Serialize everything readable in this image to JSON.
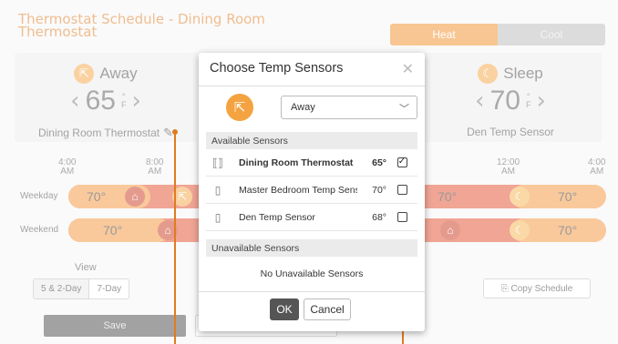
{
  "app": {
    "title": "Thermostat Schedule - Dining Room Thermostat",
    "mode_heat": "Heat",
    "mode_cool": "Cool",
    "left_panel": {
      "mode": "Away",
      "temp": "65",
      "unit_deg": "°",
      "unit_f": "F",
      "label": "Dining Room Thermostat"
    },
    "right_panel": {
      "mode": "Sleep",
      "temp": "70",
      "unit_deg": "°",
      "unit_f": "F",
      "label": "Den Temp Sensor"
    },
    "time_axis": [
      {
        "time": "4:00",
        "ampm": "AM"
      },
      {
        "time": "8:00",
        "ampm": "AM"
      },
      {
        "time": "12:00",
        "ampm": "AM"
      },
      {
        "time": "4:00",
        "ampm": "AM"
      }
    ],
    "rows": {
      "weekday_label": "Weekday",
      "weekend_label": "Weekend",
      "temp": "70°"
    },
    "view_label": "View",
    "view_options": [
      "5 & 2-Day",
      "7-Day"
    ],
    "copy_schedule": "Copy Schedule",
    "save": "Save"
  },
  "modal": {
    "title": "Choose Temp Sensors",
    "close": "✕",
    "mode_select": "Away",
    "available_header": "Available Sensors",
    "sensors": [
      {
        "name": "Dining Room Thermostat",
        "temp": "65°",
        "checked": true
      },
      {
        "name": "Master Bedroom Temp Sens...",
        "temp": "70°",
        "checked": false
      },
      {
        "name": "Den Temp Sensor",
        "temp": "68°",
        "checked": false
      }
    ],
    "unavailable_header": "Unavailable Sensors",
    "no_unavailable": "No Unavailable Sensors",
    "ok": "OK",
    "cancel": "Cancel"
  },
  "colors": {
    "accent": "#f08c24",
    "schedule_red": "#e04a2a",
    "schedule_orange": "#f29338"
  }
}
